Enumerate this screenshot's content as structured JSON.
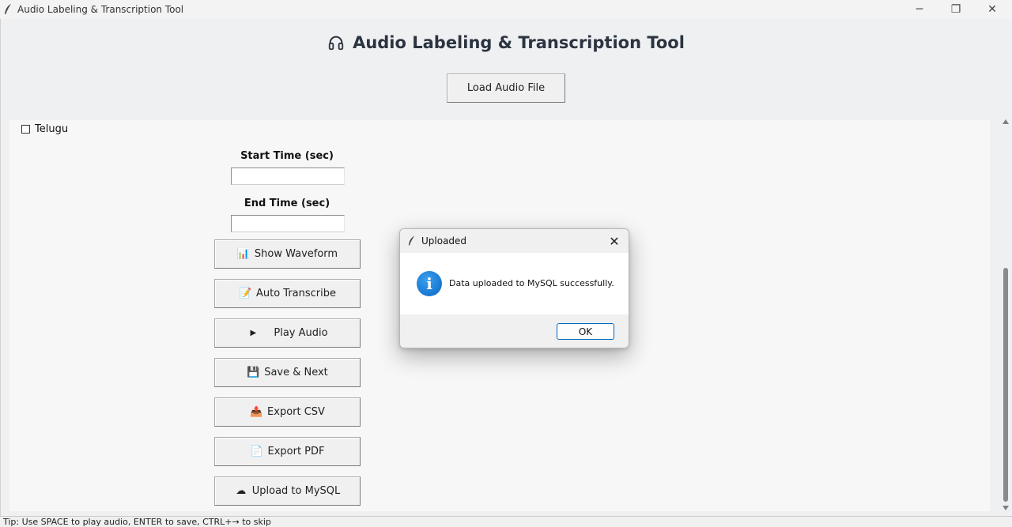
{
  "window": {
    "title": "Audio Labeling & Transcription Tool",
    "minimize_glyph": "─",
    "maximize_glyph": "❐",
    "close_glyph": "✕"
  },
  "header": {
    "title": "Audio Labeling & Transcription Tool",
    "title_icon": "headphones-icon",
    "load_button": "Load Audio File"
  },
  "options": {
    "language_checkbox_label": "Telugu",
    "language_checked": false
  },
  "fields": {
    "start_label": "Start Time (sec)",
    "start_value": "",
    "end_label": "End Time (sec)",
    "end_value": ""
  },
  "actions": [
    {
      "icon": "📊",
      "icon_name": "chart-icon",
      "label": "Show Waveform"
    },
    {
      "icon": "📝",
      "icon_name": "memo-icon",
      "label": "Auto Transcribe"
    },
    {
      "icon": "▶",
      "icon_name": "play-icon",
      "label": "Play Audio"
    },
    {
      "icon": "💾",
      "icon_name": "floppy-disk-icon",
      "label": "Save & Next"
    },
    {
      "icon": "📤",
      "icon_name": "export-tray-icon",
      "label": "Export CSV"
    },
    {
      "icon": "📄",
      "icon_name": "document-icon",
      "label": "Export PDF"
    },
    {
      "icon": "☁",
      "icon_name": "cloud-icon",
      "label": "Upload to MySQL"
    }
  ],
  "statusbar": {
    "tip": "Tip: Use SPACE to play audio, ENTER to save, CTRL+→ to skip"
  },
  "dialog": {
    "title": "Uploaded",
    "message": "Data uploaded to MySQL successfully.",
    "icon_glyph": "i",
    "close_glyph": "✕",
    "ok_label": "OK"
  },
  "colors": {
    "accent": "#0067c0",
    "info_icon": "#1877d0",
    "title_text": "#2b3440",
    "background": "#eff0f1"
  }
}
